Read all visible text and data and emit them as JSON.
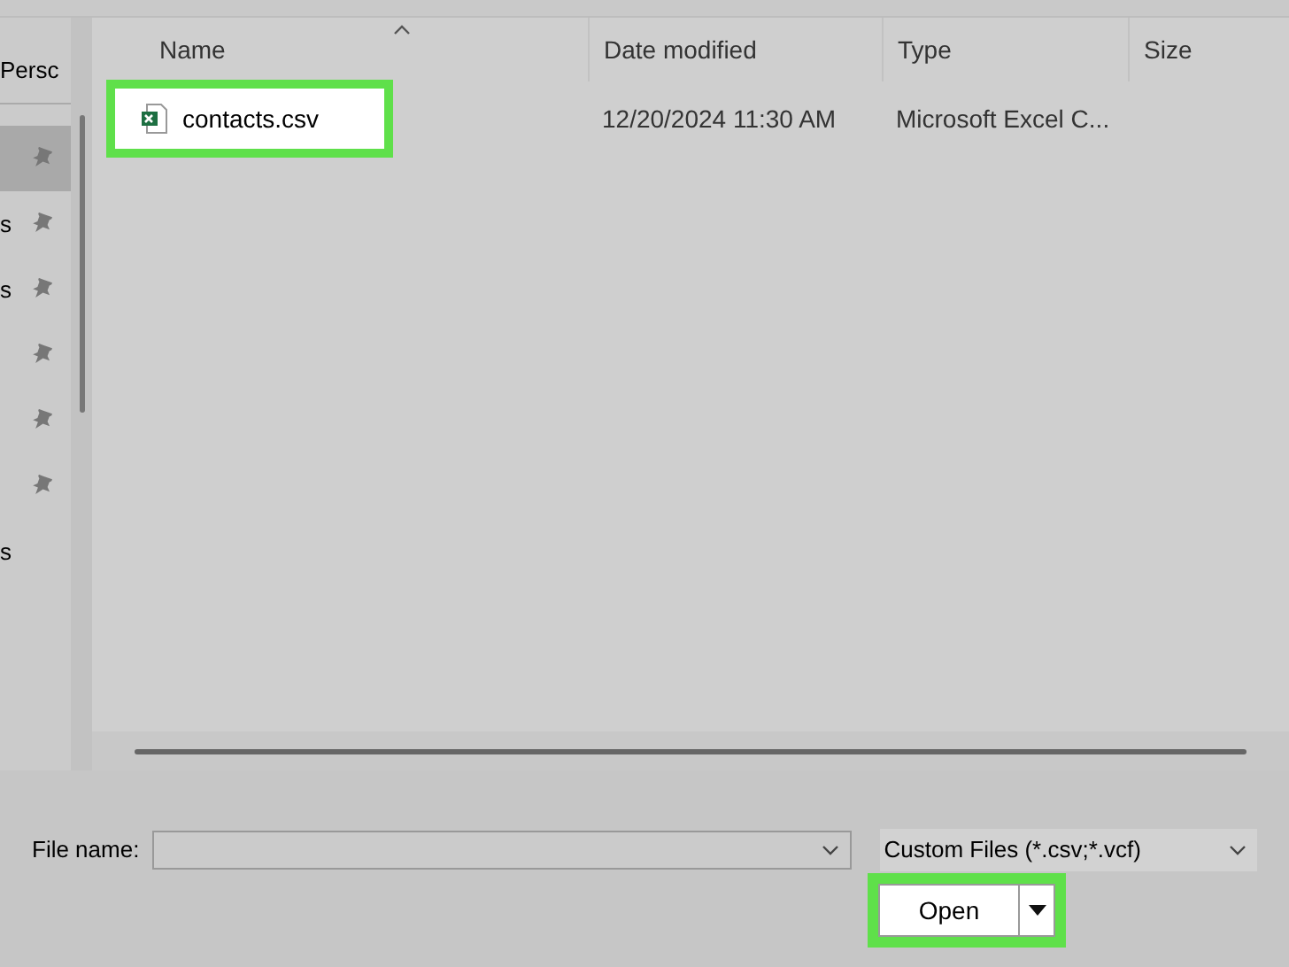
{
  "sidebar": {
    "items": [
      {
        "label": "Persc",
        "pinned": false,
        "selected": false
      },
      {
        "pinned": true,
        "selected": true
      },
      {
        "label": "s",
        "pinned": true,
        "selected": false
      },
      {
        "label": "s",
        "pinned": true,
        "selected": false
      },
      {
        "pinned": true,
        "selected": false
      },
      {
        "pinned": true,
        "selected": false
      },
      {
        "pinned": true,
        "selected": false
      },
      {
        "label": "s",
        "pinned": false,
        "selected": false
      }
    ]
  },
  "table": {
    "columns": [
      "Name",
      "Date modified",
      "Type",
      "Size"
    ],
    "rows": [
      {
        "name": "contacts.csv",
        "date_modified": "12/20/2024 11:30 AM",
        "type": "Microsoft Excel C...",
        "highlighted": true
      }
    ]
  },
  "file_name": {
    "label": "File name:"
  },
  "file_type": {
    "value": "Custom Files (*.csv;*.vcf)"
  },
  "open_button": {
    "label": "Open",
    "highlighted": true
  }
}
